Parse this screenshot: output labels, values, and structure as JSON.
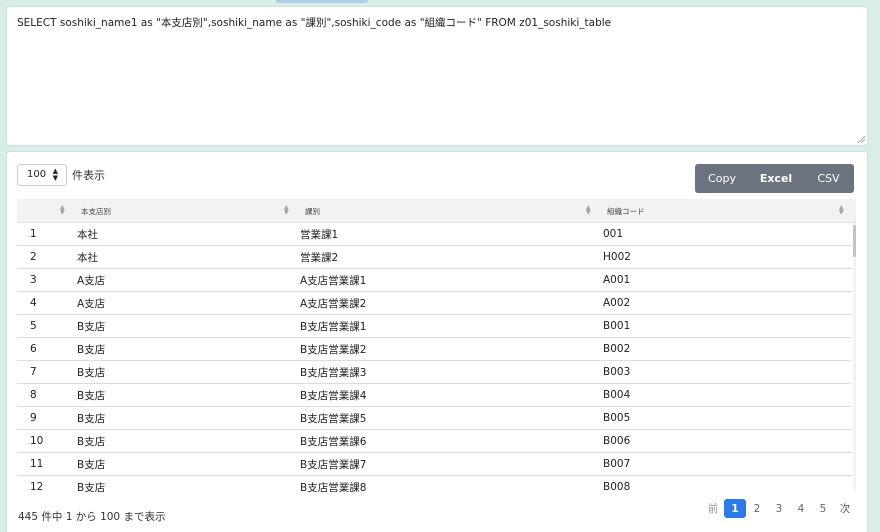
{
  "sql": {
    "query": "SELECT soshiki_name1 as \"本支店別\",soshiki_name as \"課別\",soshiki_code as \"組織コード\" FROM z01_soshiki_table"
  },
  "controls": {
    "page_length": "100",
    "page_length_label": "件表示",
    "buttons": {
      "copy": "Copy",
      "excel": "Excel",
      "csv": "CSV"
    }
  },
  "table": {
    "headers": [
      "",
      "本支店別",
      "課別",
      "組織コード"
    ],
    "rows": [
      [
        "1",
        "本社",
        "営業課1",
        "001"
      ],
      [
        "2",
        "本社",
        "営業課2",
        "H002"
      ],
      [
        "3",
        "A支店",
        "A支店営業課1",
        "A001"
      ],
      [
        "4",
        "A支店",
        "A支店営業課2",
        "A002"
      ],
      [
        "5",
        "B支店",
        "B支店営業課1",
        "B001"
      ],
      [
        "6",
        "B支店",
        "B支店営業課2",
        "B002"
      ],
      [
        "7",
        "B支店",
        "B支店営業課3",
        "B003"
      ],
      [
        "8",
        "B支店",
        "B支店営業課4",
        "B004"
      ],
      [
        "9",
        "B支店",
        "B支店営業課5",
        "B005"
      ],
      [
        "10",
        "B支店",
        "B支店営業課6",
        "B006"
      ],
      [
        "11",
        "B支店",
        "B支店営業課7",
        "B007"
      ],
      [
        "12",
        "B支店",
        "B支店営業課8",
        "B008"
      ]
    ]
  },
  "footer": {
    "info": "445 件中 1 から 100 まで表示",
    "pagination": {
      "prev": "前",
      "pages": [
        "1",
        "2",
        "3",
        "4",
        "5"
      ],
      "active": "1",
      "next": "次"
    }
  },
  "colors": {
    "accent": "#2c7be5",
    "button_group": "#6b7380",
    "background": "#d8efe9"
  },
  "icons": {
    "sort": "sort-icon",
    "select_arrows": "select-arrows-icon",
    "resize": "resize-grip-icon"
  }
}
